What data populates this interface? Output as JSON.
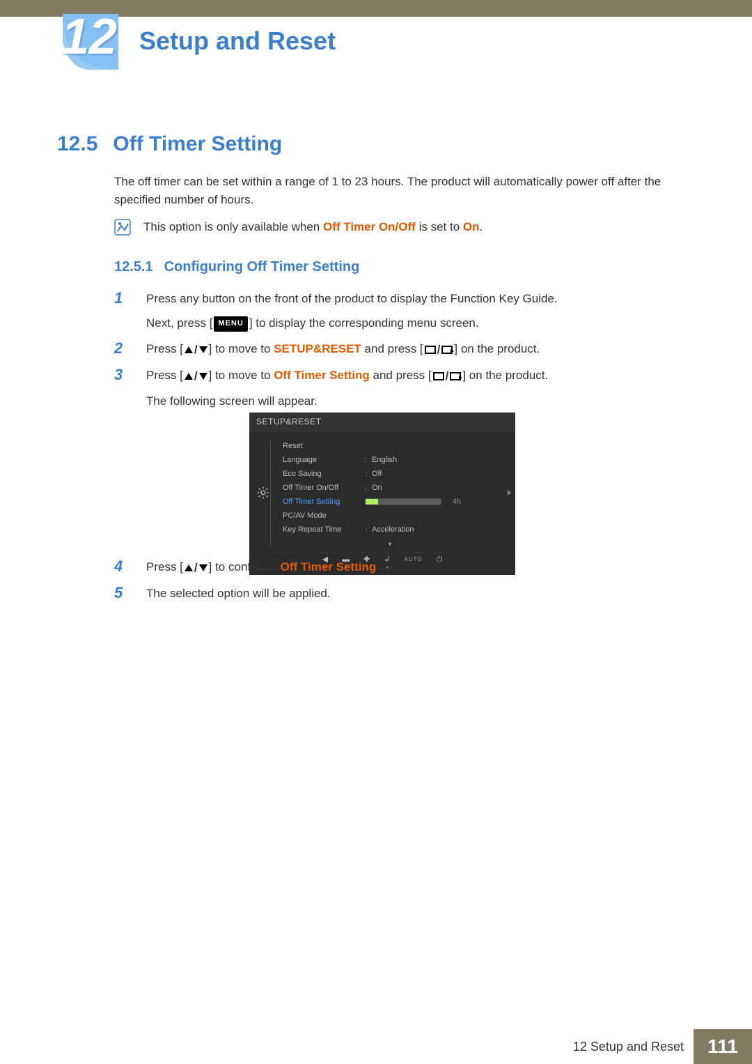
{
  "chapter": {
    "number": "12",
    "title": "Setup and Reset"
  },
  "section": {
    "number": "12.5",
    "title": "Off Timer Setting"
  },
  "intro": "The off timer can be set within a range of 1 to 23 hours. The product will automatically power off after the specified number of hours.",
  "note": {
    "prefix": "This option is only available when ",
    "emph1": "Off Timer On/Off",
    "mid": " is set to ",
    "emph2": "On",
    "suffix": "."
  },
  "subsec": {
    "number": "12.5.1",
    "title": "Configuring Off Timer Setting"
  },
  "steps": {
    "label1": "1",
    "s1a": "Press any button on the front of the product to display the Function Key Guide.",
    "s1b_pre": "Next, press [",
    "menu_label": "MENU",
    "s1b_post": "] to display the corresponding menu screen.",
    "label2": "2",
    "s2_pre": "Press [",
    "s2_mid": "] to move to ",
    "s2_emph": "SETUP&RESET",
    "s2_and": " and press [",
    "s2_end": "] on the product.",
    "label3": "3",
    "s3_pre": "Press [",
    "s3_mid": "] to move to ",
    "s3_emph": "Off Timer Setting",
    "s3_and": " and press [",
    "s3_end": "] on the product.",
    "s3_line2": "The following screen will appear.",
    "label4": "4",
    "s4_pre": "Press [",
    "s4_mid": "] to configure ",
    "s4_emph": "Off Timer Setting",
    "s4_end": ".",
    "label5": "5",
    "s5": "The selected option will be applied."
  },
  "osd": {
    "title": "SETUP&RESET",
    "items": [
      {
        "label": "Reset",
        "value": ""
      },
      {
        "label": "Language",
        "value": "English"
      },
      {
        "label": "Eco Saving",
        "value": "Off"
      },
      {
        "label": "Off Timer On/Off",
        "value": "On"
      },
      {
        "label": "Off Timer Setting",
        "slider_value": "4h",
        "slider_pct": 17,
        "highlight": true
      },
      {
        "label": "PC/AV Mode",
        "value": ""
      },
      {
        "label": "Key Repeat Time",
        "value": "Acceleration"
      }
    ],
    "bottom": {
      "auto": "AUTO"
    }
  },
  "footer": {
    "chapter_label": "12 Setup and Reset",
    "page": "111"
  }
}
